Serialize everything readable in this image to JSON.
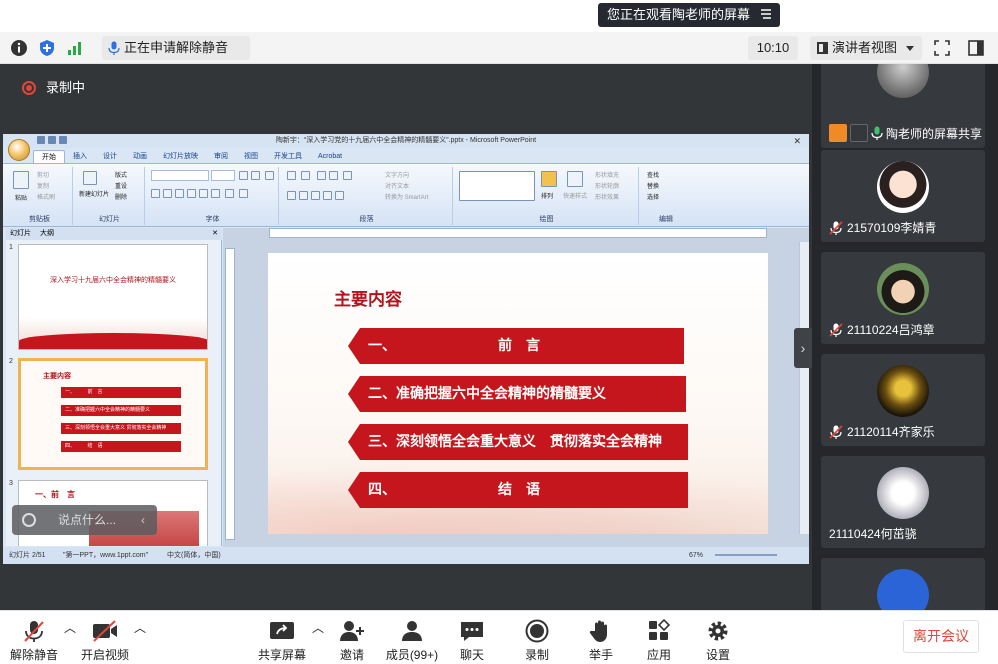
{
  "watch_tip": {
    "text": "您正在观看陶老师的屏幕"
  },
  "topbar": {
    "unmute_request": "正在申请解除静音",
    "clock": "10:10",
    "view_mode": "演讲者视图"
  },
  "stage": {
    "recording": "录制中",
    "chat_placeholder": "说点什么..."
  },
  "powerpoint": {
    "window_title": "陶新宇：“深入学习党的十九届六中全会精神的精髓要义”.pptx - Microsoft PowerPoint",
    "tabs": [
      "开始",
      "插入",
      "设计",
      "动画",
      "幻灯片放映",
      "审阅",
      "视图",
      "开发工具",
      "Acrobat"
    ],
    "ribbon": {
      "clipboard_group": "剪贴板",
      "paste": "粘贴",
      "cut": "剪切",
      "copy": "复制",
      "format_painter": "格式刷",
      "slides_group": "幻灯片",
      "new_slide": "新建幻灯片",
      "layout": "版式",
      "reset": "重设",
      "delete": "删除",
      "font_group": "字体",
      "paragraph_group": "段落",
      "text_direction": "文字方向",
      "align_text": "对齐文本",
      "convert_smartart": "转换为 SmartArt",
      "drawing_group": "绘图",
      "arrange": "排列",
      "quick_styles": "快速样式",
      "shape_fill": "形状填充",
      "shape_outline": "形状轮廓",
      "shape_effects": "形状效果",
      "editing_group": "编辑",
      "find": "查找",
      "replace": "替换",
      "select": "选择"
    },
    "panel_tabs": [
      "幻灯片",
      "大纲"
    ],
    "thumbnails": [
      {
        "num": "1",
        "title": "深入学习十九届六中全会精神的精髓要义"
      },
      {
        "num": "2",
        "title": "主要内容",
        "items": [
          "一、　　　前　言",
          "二、准确把握六中全会精神的精髓要义",
          "三、深刻领悟全会重大意义 贯彻落实全会精神",
          "四、　　　结　语"
        ]
      },
      {
        "num": "3",
        "title": "一、前　言"
      }
    ],
    "slide": {
      "heading": "主要内容",
      "items": [
        {
          "num": "一、",
          "text": "前　言"
        },
        {
          "num": "",
          "text": "二、准确把握六中全会精神的精髓要义"
        },
        {
          "num": "",
          "text": "三、深刻领悟全会重大意义　贯彻落实全会精神"
        },
        {
          "num": "四、",
          "text": "结　语"
        }
      ]
    },
    "status": {
      "slide_pos": "幻灯片 2/51",
      "theme": "\"第一PPT，www.1ppt.com\"",
      "lang": "中文(简体，中国)",
      "zoom": "67%"
    }
  },
  "participants": [
    {
      "name": "陶老师的屏幕共享",
      "type": "sharing"
    },
    {
      "name": "21570109李婧青",
      "muted": true
    },
    {
      "name": "21110224吕鸿章",
      "muted": true
    },
    {
      "name": "21120114齐家乐",
      "muted": true
    },
    {
      "name": "21110424何茁骁",
      "muted": false
    },
    {
      "name": "",
      "muted": false
    }
  ],
  "bottombar": {
    "unmute": "解除静音",
    "start_video": "开启视频",
    "share_screen": "共享屏幕",
    "invite": "邀请",
    "members": "成员(99+)",
    "chat": "聊天",
    "record": "录制",
    "raise_hand": "举手",
    "apps": "应用",
    "settings": "设置",
    "leave": "离开会议"
  },
  "colors": {
    "accent_red": "#c4161c",
    "leave_red": "#e0463a",
    "dark_bg": "#333639"
  }
}
